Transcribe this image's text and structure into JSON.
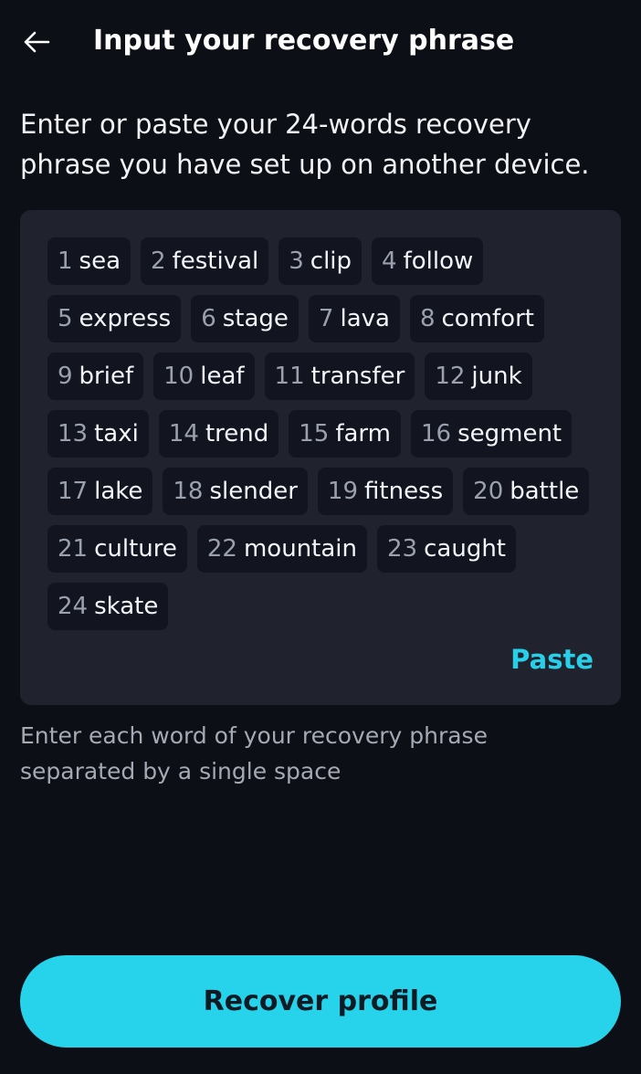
{
  "header": {
    "back_icon": "arrow-left-icon",
    "title": "Input your recovery phrase"
  },
  "intro": "Enter or paste your 24-words recovery phrase you have set up on another device.",
  "phrase": {
    "words": [
      {
        "num": "1",
        "word": "sea"
      },
      {
        "num": "2",
        "word": "festival"
      },
      {
        "num": "3",
        "word": "clip"
      },
      {
        "num": "4",
        "word": "follow"
      },
      {
        "num": "5",
        "word": "express"
      },
      {
        "num": "6",
        "word": "stage"
      },
      {
        "num": "7",
        "word": "lava"
      },
      {
        "num": "8",
        "word": "comfort"
      },
      {
        "num": "9",
        "word": "brief"
      },
      {
        "num": "10",
        "word": "leaf"
      },
      {
        "num": "11",
        "word": "transfer"
      },
      {
        "num": "12",
        "word": "junk"
      },
      {
        "num": "13",
        "word": "taxi"
      },
      {
        "num": "14",
        "word": "trend"
      },
      {
        "num": "15",
        "word": "farm"
      },
      {
        "num": "16",
        "word": "segment"
      },
      {
        "num": "17",
        "word": "lake"
      },
      {
        "num": "18",
        "word": "slender"
      },
      {
        "num": "19",
        "word": "fitness"
      },
      {
        "num": "20",
        "word": "battle"
      },
      {
        "num": "21",
        "word": "culture"
      },
      {
        "num": "22",
        "word": "mountain"
      },
      {
        "num": "23",
        "word": "caught"
      },
      {
        "num": "24",
        "word": "skate"
      }
    ],
    "paste_label": "Paste"
  },
  "hint": "Enter each word of your recovery phrase separated by a single space",
  "recover_label": "Recover profile",
  "colors": {
    "background": "#0c0f16",
    "panel": "#20232d",
    "chip": "#121520",
    "accent": "#26d3ea"
  }
}
